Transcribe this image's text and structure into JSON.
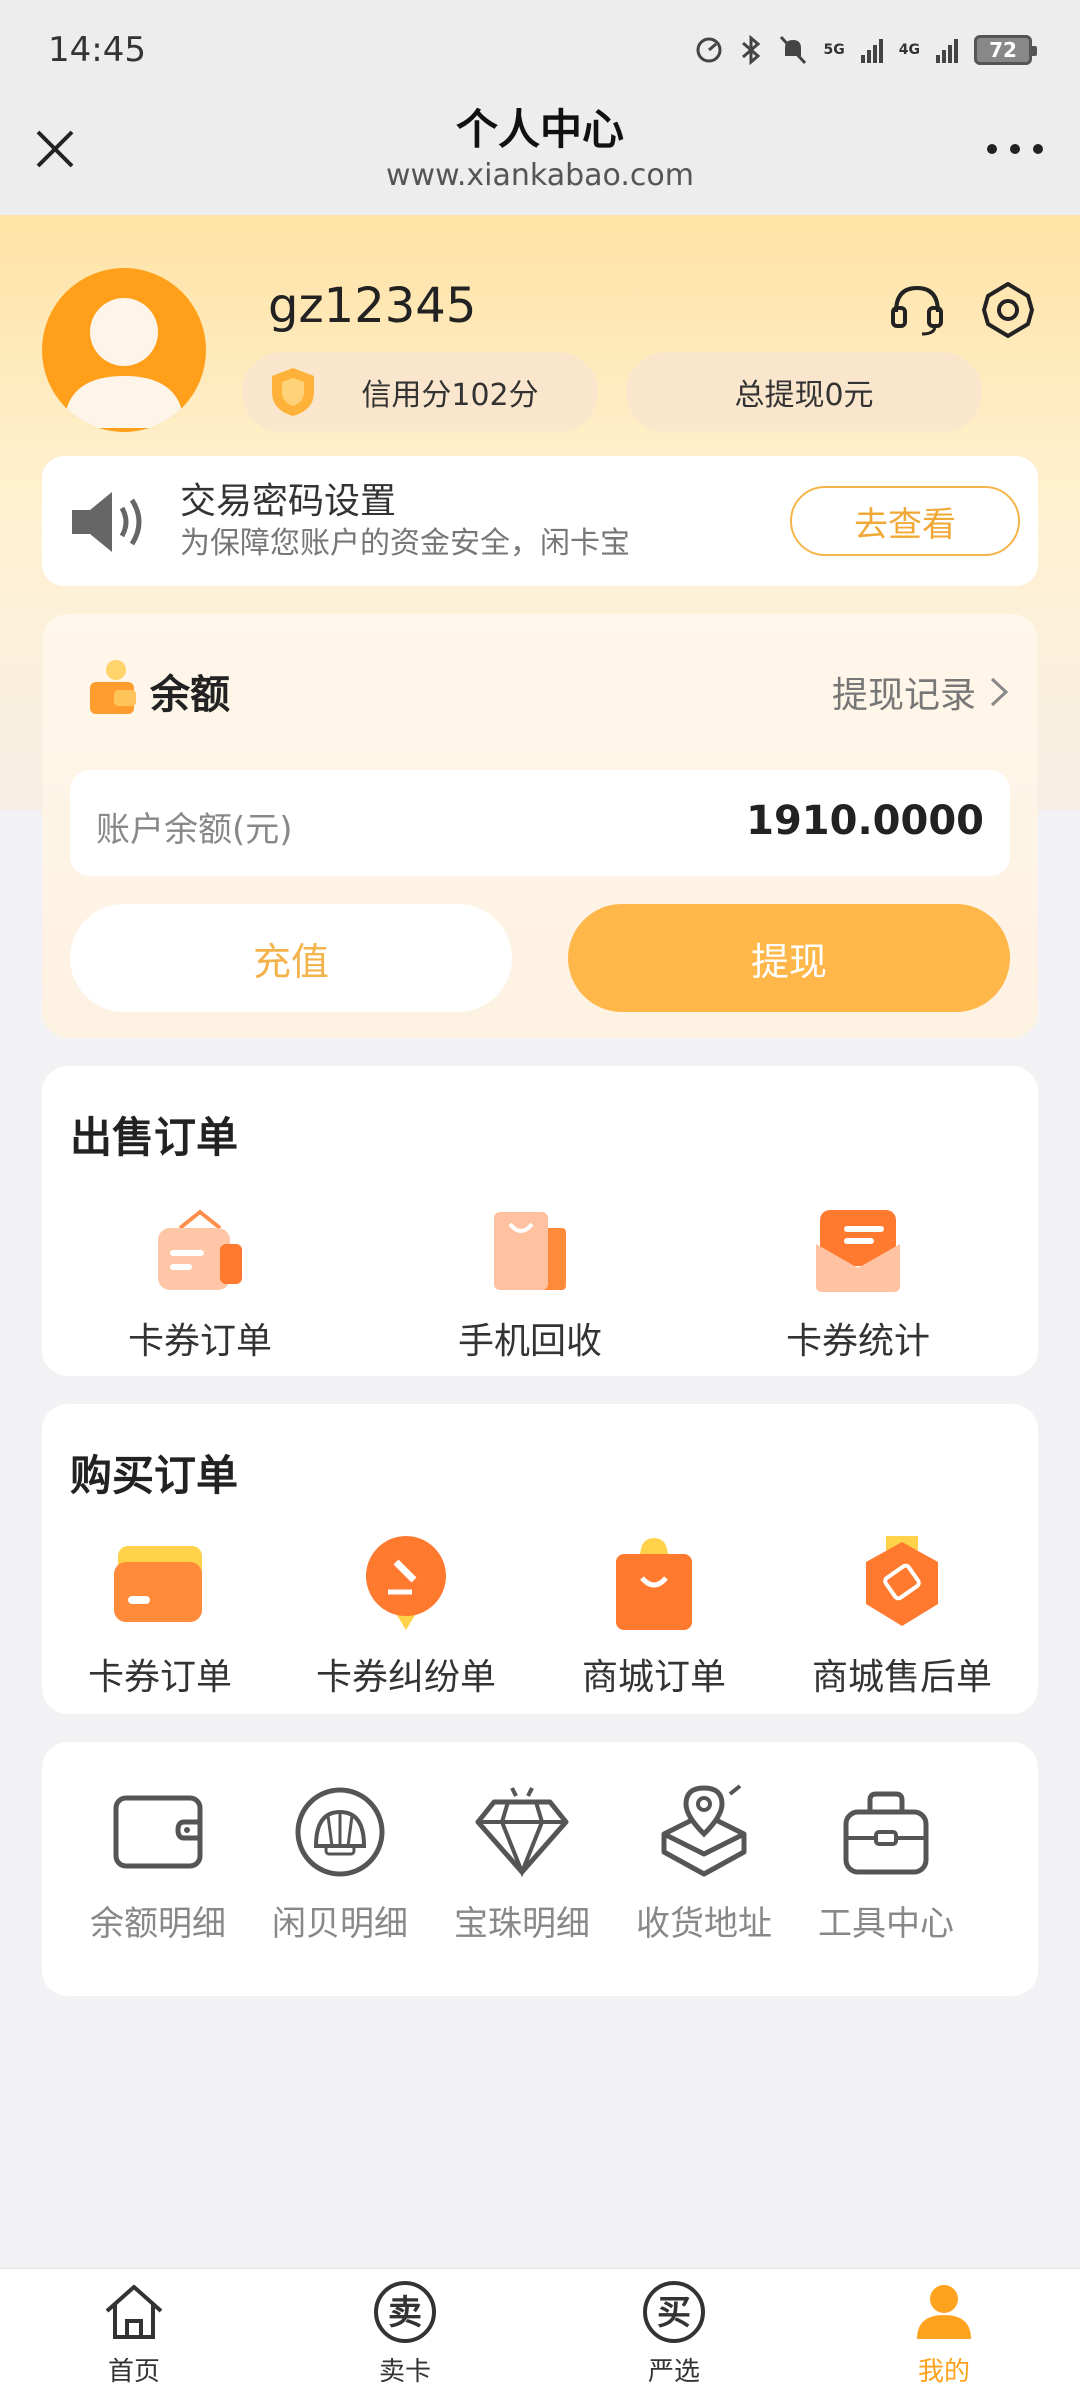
{
  "status_bar": {
    "time": "14:45",
    "net1": "5G",
    "net2": "4G",
    "battery": "72"
  },
  "navbar": {
    "title": "个人中心",
    "url": "www.xiankabao.com"
  },
  "profile": {
    "username": "gz12345",
    "credit": "信用分102分",
    "total_withdraw": "总提现0元"
  },
  "notice": {
    "title": "交易密码设置",
    "description": "为保障您账户的资金安全，闲卡宝",
    "button": "去查看"
  },
  "balance": {
    "title": "余额",
    "record_link": "提现记录",
    "account_label": "账户余额(元)",
    "account_value": "1910.0000",
    "recharge": "充值",
    "withdraw": "提现"
  },
  "sell_orders": {
    "title": "出售订单",
    "items": [
      {
        "label": "卡券订单",
        "icon": "bag-card-icon"
      },
      {
        "label": "手机回收",
        "icon": "shopping-bag-icon"
      },
      {
        "label": "卡券统计",
        "icon": "envelope-icon"
      }
    ]
  },
  "buy_orders": {
    "title": "购买订单",
    "items": [
      {
        "label": "卡券订单",
        "icon": "card-icon"
      },
      {
        "label": "卡券纠纷单",
        "icon": "gavel-medal-icon"
      },
      {
        "label": "商城订单",
        "icon": "smile-bag-icon"
      },
      {
        "label": "商城售后单",
        "icon": "tag-badge-icon"
      }
    ]
  },
  "tools": {
    "items": [
      {
        "label": "余额明细",
        "icon": "wallet-icon"
      },
      {
        "label": "闲贝明细",
        "icon": "shell-icon"
      },
      {
        "label": "宝珠明细",
        "icon": "diamond-icon"
      },
      {
        "label": "收货地址",
        "icon": "location-box-icon"
      },
      {
        "label": "工具中心",
        "icon": "toolbox-icon"
      }
    ]
  },
  "tabbar": {
    "items": [
      {
        "label": "首页",
        "icon": "home-icon"
      },
      {
        "label": "卖卡",
        "icon": "sell-icon",
        "glyph": "卖"
      },
      {
        "label": "严选",
        "icon": "buy-icon",
        "glyph": "买"
      },
      {
        "label": "我的",
        "icon": "profile-icon"
      }
    ],
    "active_index": 3
  },
  "colors": {
    "accent": "#ffb749",
    "accent_text": "#f4b24a",
    "active_tab": "#ffa21d"
  }
}
